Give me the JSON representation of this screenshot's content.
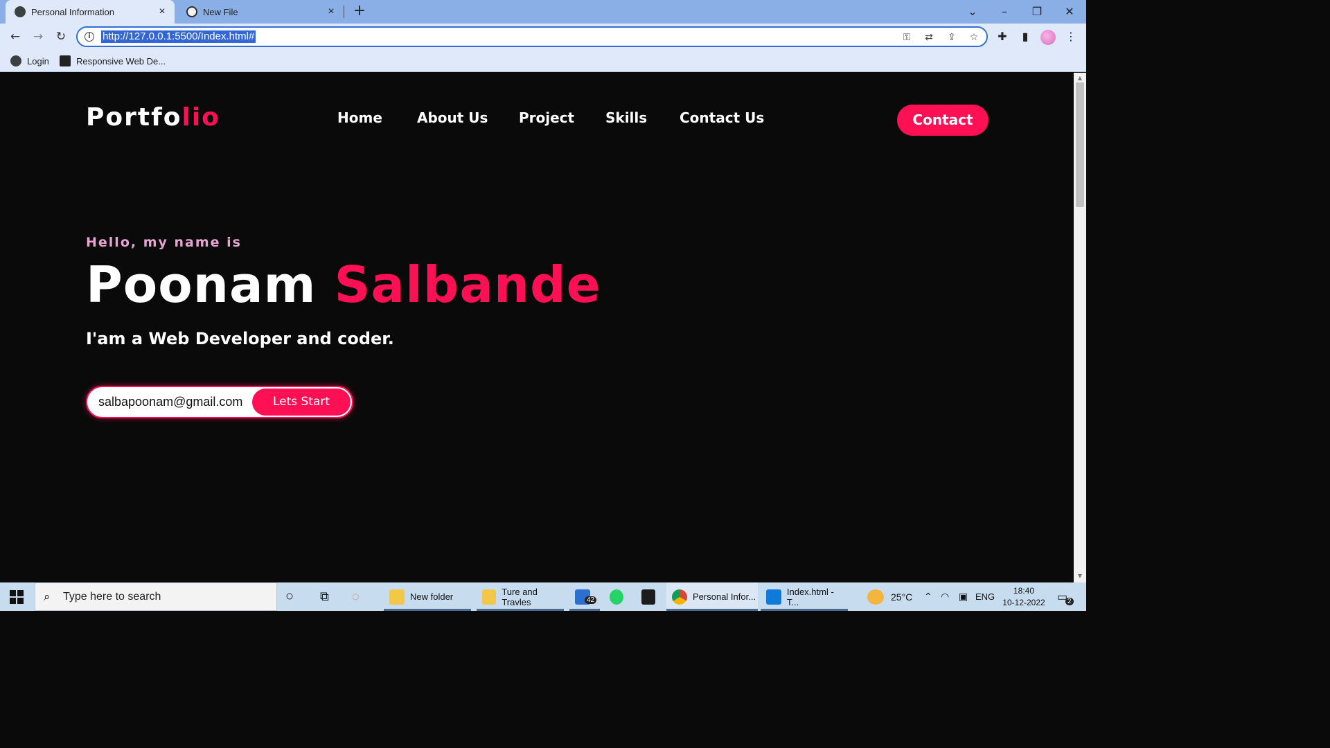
{
  "browser": {
    "tabs": [
      {
        "title": "Personal Information",
        "active": true
      },
      {
        "title": "New File",
        "active": false
      }
    ],
    "url": "http://127.0.0.1:5500/Index.html#",
    "bookmarks": [
      {
        "label": "Login"
      },
      {
        "label": "Responsive Web De..."
      }
    ]
  },
  "site": {
    "logo_main": "Portfo",
    "logo_accent": "lio",
    "nav": [
      "Home",
      "About Us",
      "Project",
      "Skills",
      "Contact Us"
    ],
    "contact_button": "Contact",
    "hello": "Hello, my name is",
    "first_name": "Poonam",
    "last_name": "Salbande",
    "tagline": "I'am a Web Developer and coder.",
    "email_value": "salbapoonam@gmail.com",
    "start_button": "Lets Start",
    "colors": {
      "accent": "#ff1055",
      "background": "#0b0a0b",
      "hello": "#e7a4d0"
    }
  },
  "taskbar": {
    "search_placeholder": "Type here to search",
    "apps": [
      {
        "label": "New folder"
      },
      {
        "label": "Ture and Travles"
      },
      {
        "label": "Personal Infor..."
      },
      {
        "label": "Index.html - T..."
      }
    ],
    "mail_badge": "42",
    "weather": "25°C",
    "language": "ENG",
    "time": "18:40",
    "date": "10-12-2022",
    "notification_count": "2"
  }
}
